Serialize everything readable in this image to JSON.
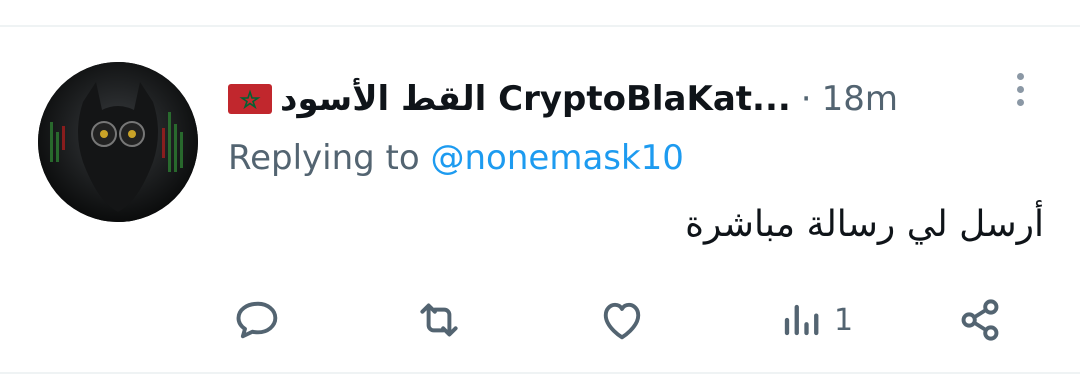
{
  "tweet": {
    "display_name": "القط الأسود CryptoBlaKat...",
    "flag_icon": "morocco-flag-icon",
    "separator": "·",
    "time": "18m",
    "replying_prefix": "Replying to",
    "replying_handle": "@nonemask10",
    "text": "أرسل لي رسالة مباشرة"
  },
  "actions": {
    "reply": {
      "icon": "reply-icon",
      "count": ""
    },
    "retweet": {
      "icon": "retweet-icon",
      "count": ""
    },
    "like": {
      "icon": "heart-icon",
      "count": ""
    },
    "views": {
      "icon": "views-icon",
      "count": "1"
    },
    "share": {
      "icon": "share-icon",
      "count": ""
    }
  },
  "colors": {
    "text_primary": "#0f1419",
    "text_secondary": "#536471",
    "link": "#1d9bf0",
    "divider": "#eff3f4"
  }
}
